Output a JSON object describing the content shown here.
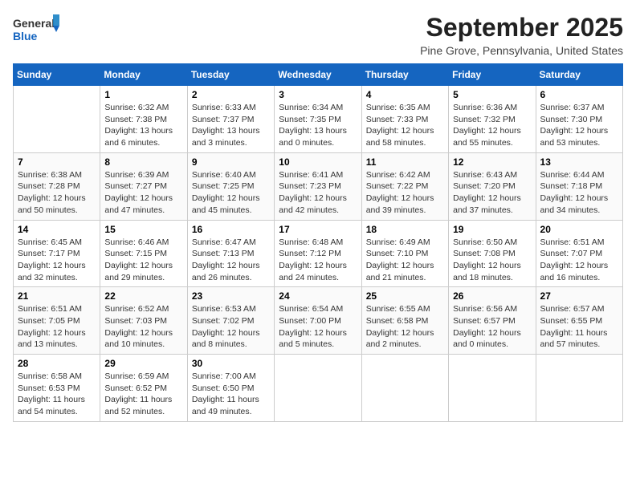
{
  "app": {
    "logo_line1": "General",
    "logo_line2": "Blue"
  },
  "title": "September 2025",
  "location": "Pine Grove, Pennsylvania, United States",
  "days_of_week": [
    "Sunday",
    "Monday",
    "Tuesday",
    "Wednesday",
    "Thursday",
    "Friday",
    "Saturday"
  ],
  "weeks": [
    [
      {
        "day": "",
        "sunrise": "",
        "sunset": "",
        "daylight": ""
      },
      {
        "day": "1",
        "sunrise": "Sunrise: 6:32 AM",
        "sunset": "Sunset: 7:38 PM",
        "daylight": "Daylight: 13 hours and 6 minutes."
      },
      {
        "day": "2",
        "sunrise": "Sunrise: 6:33 AM",
        "sunset": "Sunset: 7:37 PM",
        "daylight": "Daylight: 13 hours and 3 minutes."
      },
      {
        "day": "3",
        "sunrise": "Sunrise: 6:34 AM",
        "sunset": "Sunset: 7:35 PM",
        "daylight": "Daylight: 13 hours and 0 minutes."
      },
      {
        "day": "4",
        "sunrise": "Sunrise: 6:35 AM",
        "sunset": "Sunset: 7:33 PM",
        "daylight": "Daylight: 12 hours and 58 minutes."
      },
      {
        "day": "5",
        "sunrise": "Sunrise: 6:36 AM",
        "sunset": "Sunset: 7:32 PM",
        "daylight": "Daylight: 12 hours and 55 minutes."
      },
      {
        "day": "6",
        "sunrise": "Sunrise: 6:37 AM",
        "sunset": "Sunset: 7:30 PM",
        "daylight": "Daylight: 12 hours and 53 minutes."
      }
    ],
    [
      {
        "day": "7",
        "sunrise": "Sunrise: 6:38 AM",
        "sunset": "Sunset: 7:28 PM",
        "daylight": "Daylight: 12 hours and 50 minutes."
      },
      {
        "day": "8",
        "sunrise": "Sunrise: 6:39 AM",
        "sunset": "Sunset: 7:27 PM",
        "daylight": "Daylight: 12 hours and 47 minutes."
      },
      {
        "day": "9",
        "sunrise": "Sunrise: 6:40 AM",
        "sunset": "Sunset: 7:25 PM",
        "daylight": "Daylight: 12 hours and 45 minutes."
      },
      {
        "day": "10",
        "sunrise": "Sunrise: 6:41 AM",
        "sunset": "Sunset: 7:23 PM",
        "daylight": "Daylight: 12 hours and 42 minutes."
      },
      {
        "day": "11",
        "sunrise": "Sunrise: 6:42 AM",
        "sunset": "Sunset: 7:22 PM",
        "daylight": "Daylight: 12 hours and 39 minutes."
      },
      {
        "day": "12",
        "sunrise": "Sunrise: 6:43 AM",
        "sunset": "Sunset: 7:20 PM",
        "daylight": "Daylight: 12 hours and 37 minutes."
      },
      {
        "day": "13",
        "sunrise": "Sunrise: 6:44 AM",
        "sunset": "Sunset: 7:18 PM",
        "daylight": "Daylight: 12 hours and 34 minutes."
      }
    ],
    [
      {
        "day": "14",
        "sunrise": "Sunrise: 6:45 AM",
        "sunset": "Sunset: 7:17 PM",
        "daylight": "Daylight: 12 hours and 32 minutes."
      },
      {
        "day": "15",
        "sunrise": "Sunrise: 6:46 AM",
        "sunset": "Sunset: 7:15 PM",
        "daylight": "Daylight: 12 hours and 29 minutes."
      },
      {
        "day": "16",
        "sunrise": "Sunrise: 6:47 AM",
        "sunset": "Sunset: 7:13 PM",
        "daylight": "Daylight: 12 hours and 26 minutes."
      },
      {
        "day": "17",
        "sunrise": "Sunrise: 6:48 AM",
        "sunset": "Sunset: 7:12 PM",
        "daylight": "Daylight: 12 hours and 24 minutes."
      },
      {
        "day": "18",
        "sunrise": "Sunrise: 6:49 AM",
        "sunset": "Sunset: 7:10 PM",
        "daylight": "Daylight: 12 hours and 21 minutes."
      },
      {
        "day": "19",
        "sunrise": "Sunrise: 6:50 AM",
        "sunset": "Sunset: 7:08 PM",
        "daylight": "Daylight: 12 hours and 18 minutes."
      },
      {
        "day": "20",
        "sunrise": "Sunrise: 6:51 AM",
        "sunset": "Sunset: 7:07 PM",
        "daylight": "Daylight: 12 hours and 16 minutes."
      }
    ],
    [
      {
        "day": "21",
        "sunrise": "Sunrise: 6:51 AM",
        "sunset": "Sunset: 7:05 PM",
        "daylight": "Daylight: 12 hours and 13 minutes."
      },
      {
        "day": "22",
        "sunrise": "Sunrise: 6:52 AM",
        "sunset": "Sunset: 7:03 PM",
        "daylight": "Daylight: 12 hours and 10 minutes."
      },
      {
        "day": "23",
        "sunrise": "Sunrise: 6:53 AM",
        "sunset": "Sunset: 7:02 PM",
        "daylight": "Daylight: 12 hours and 8 minutes."
      },
      {
        "day": "24",
        "sunrise": "Sunrise: 6:54 AM",
        "sunset": "Sunset: 7:00 PM",
        "daylight": "Daylight: 12 hours and 5 minutes."
      },
      {
        "day": "25",
        "sunrise": "Sunrise: 6:55 AM",
        "sunset": "Sunset: 6:58 PM",
        "daylight": "Daylight: 12 hours and 2 minutes."
      },
      {
        "day": "26",
        "sunrise": "Sunrise: 6:56 AM",
        "sunset": "Sunset: 6:57 PM",
        "daylight": "Daylight: 12 hours and 0 minutes."
      },
      {
        "day": "27",
        "sunrise": "Sunrise: 6:57 AM",
        "sunset": "Sunset: 6:55 PM",
        "daylight": "Daylight: 11 hours and 57 minutes."
      }
    ],
    [
      {
        "day": "28",
        "sunrise": "Sunrise: 6:58 AM",
        "sunset": "Sunset: 6:53 PM",
        "daylight": "Daylight: 11 hours and 54 minutes."
      },
      {
        "day": "29",
        "sunrise": "Sunrise: 6:59 AM",
        "sunset": "Sunset: 6:52 PM",
        "daylight": "Daylight: 11 hours and 52 minutes."
      },
      {
        "day": "30",
        "sunrise": "Sunrise: 7:00 AM",
        "sunset": "Sunset: 6:50 PM",
        "daylight": "Daylight: 11 hours and 49 minutes."
      },
      {
        "day": "",
        "sunrise": "",
        "sunset": "",
        "daylight": ""
      },
      {
        "day": "",
        "sunrise": "",
        "sunset": "",
        "daylight": ""
      },
      {
        "day": "",
        "sunrise": "",
        "sunset": "",
        "daylight": ""
      },
      {
        "day": "",
        "sunrise": "",
        "sunset": "",
        "daylight": ""
      }
    ]
  ]
}
